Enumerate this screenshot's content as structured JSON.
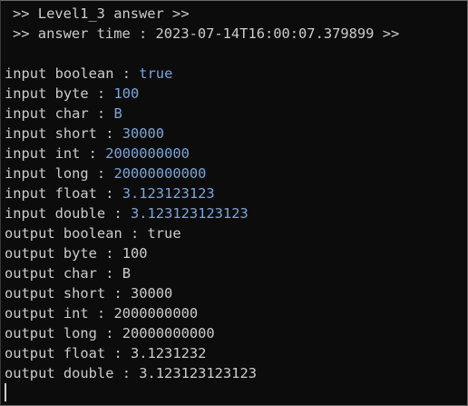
{
  "header": {
    "title": ">> Level1_3 answer >>",
    "time_line": ">> answer time : 2023-07-14T16:00:07.379899 >>"
  },
  "inputs": [
    {
      "label": "input boolean : ",
      "value": "true"
    },
    {
      "label": "input byte : ",
      "value": "100"
    },
    {
      "label": "input char : ",
      "value": "B"
    },
    {
      "label": "input short : ",
      "value": "30000"
    },
    {
      "label": "input int : ",
      "value": "2000000000"
    },
    {
      "label": "input long : ",
      "value": "20000000000"
    },
    {
      "label": "input float : ",
      "value": "3.123123123"
    },
    {
      "label": "input double : ",
      "value": "3.123123123123"
    }
  ],
  "outputs": [
    {
      "text": "output boolean : true"
    },
    {
      "text": "output byte : 100"
    },
    {
      "text": "output char : B"
    },
    {
      "text": "output short : 30000"
    },
    {
      "text": "output int : 2000000000"
    },
    {
      "text": "output long : 20000000000"
    },
    {
      "text": "output float : 3.1231232"
    },
    {
      "text": "output double : 3.123123123123"
    }
  ],
  "colors": {
    "background": "#0c0c0c",
    "text": "#cccccc",
    "input_value": "#7aa6da"
  }
}
